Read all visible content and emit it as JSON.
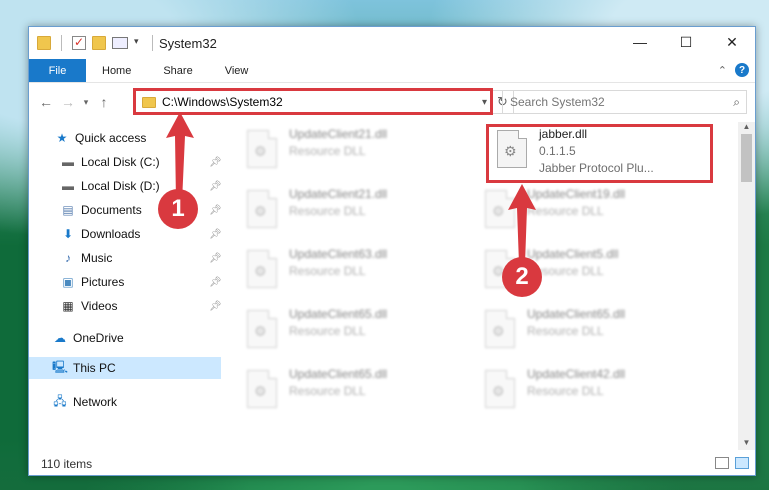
{
  "window": {
    "title": "System32",
    "controls": [
      "—",
      "☐",
      "✕"
    ]
  },
  "ribbon": {
    "tabs": [
      "File",
      "Home",
      "Share",
      "View"
    ]
  },
  "address_bar": {
    "path": "C:\\Windows\\System32"
  },
  "search": {
    "placeholder": "Search System32"
  },
  "sidebar": {
    "items": [
      {
        "label": "Quick access",
        "icon": "star-icon"
      },
      {
        "label": "Local Disk (C:)",
        "icon": "drive-icon",
        "pinned": true
      },
      {
        "label": "Local Disk (D:)",
        "icon": "drive-icon",
        "pinned": true
      },
      {
        "label": "Documents",
        "icon": "documents-icon",
        "pinned": true
      },
      {
        "label": "Downloads",
        "icon": "download-icon",
        "pinned": true
      },
      {
        "label": "Music",
        "icon": "music-icon",
        "pinned": true
      },
      {
        "label": "Pictures",
        "icon": "pictures-icon",
        "pinned": true
      },
      {
        "label": "Videos",
        "icon": "videos-icon",
        "pinned": true
      },
      {
        "label": "OneDrive",
        "icon": "cloud-icon"
      },
      {
        "label": "This PC",
        "icon": "computer-icon",
        "selected": true
      },
      {
        "label": "Network",
        "icon": "network-icon"
      }
    ]
  },
  "files": {
    "highlighted": {
      "name": "jabber.dll",
      "version": "0.1.1.5",
      "description": "Jabber Protocol Plu..."
    },
    "left_column": [
      {
        "name": "UpdateClient21.dll",
        "type": "Resource DLL"
      },
      {
        "name": "UpdateClient21.dll",
        "type": "Resource DLL"
      },
      {
        "name": "UpdateClient63.dll",
        "type": "Resource DLL"
      },
      {
        "name": "UpdateClient65.dll",
        "type": "Resource DLL"
      },
      {
        "name": "UpdateClient65.dll",
        "type": "Resource DLL"
      }
    ],
    "right_column": [
      {
        "name": "UpdateClient19.dll",
        "type": "Resource DLL"
      },
      {
        "name": "UpdateClient5.dll",
        "type": "Resource DLL"
      },
      {
        "name": "UpdateClient65.dll",
        "type": "Resource DLL"
      },
      {
        "name": "UpdateClient42.dll",
        "type": "Resource DLL"
      }
    ]
  },
  "status": {
    "item_count": "110 items"
  },
  "annotations": {
    "step1": "1",
    "step2": "2"
  },
  "colors": {
    "accent": "#1979ca",
    "highlight_box": "#d9393f",
    "selected_nav": "#cce8ff"
  }
}
